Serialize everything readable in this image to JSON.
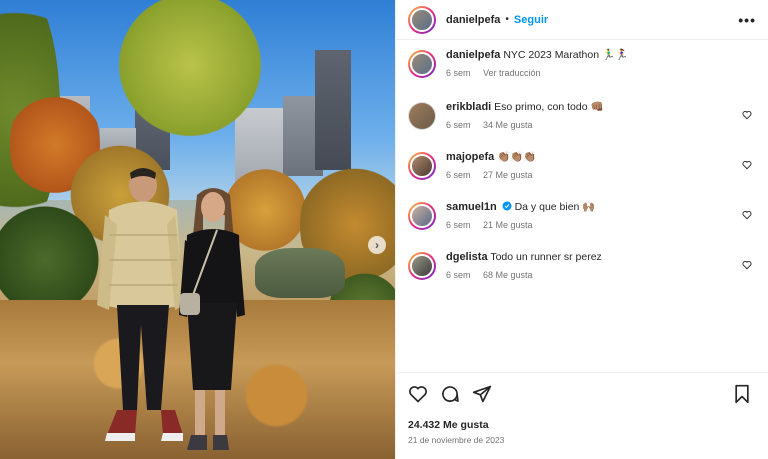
{
  "post_header": {
    "username": "danielpefa",
    "separator": "•",
    "follow_label": "Seguir",
    "more_label": "•••"
  },
  "caption": {
    "username": "danielpefa",
    "text": "NYC 2023 Marathon 🏃‍♂️🏃‍♀️",
    "time": "6 sem",
    "translate_label": "Ver traducción"
  },
  "comments": [
    {
      "username": "erikbladi",
      "text": "Eso primo, con todo 👊🏽",
      "time": "6 sem",
      "likes": "34 Me gusta",
      "verified": false
    },
    {
      "username": "majopefa",
      "text": "👏🏽👏🏽👏🏽",
      "time": "6 sem",
      "likes": "27 Me gusta",
      "verified": false
    },
    {
      "username": "samuel1n",
      "text": "Da y que bien 🙌🏽",
      "time": "6 sem",
      "likes": "21 Me gusta",
      "verified": true
    },
    {
      "username": "dgelista",
      "text": "Todo un runner sr perez",
      "time": "6 sem",
      "likes": "68 Me gusta",
      "verified": false
    }
  ],
  "footer": {
    "likes": "24.432 Me gusta",
    "date": "21 de noviembre de 2023"
  },
  "icons": {
    "like": "heart-icon",
    "comment": "comment-icon",
    "share": "share-icon",
    "save": "bookmark-icon",
    "next": "chevron-right-icon"
  },
  "colors": {
    "link": "#0095f6",
    "muted": "#737373",
    "text": "#262626",
    "verified": "#0095f6"
  }
}
